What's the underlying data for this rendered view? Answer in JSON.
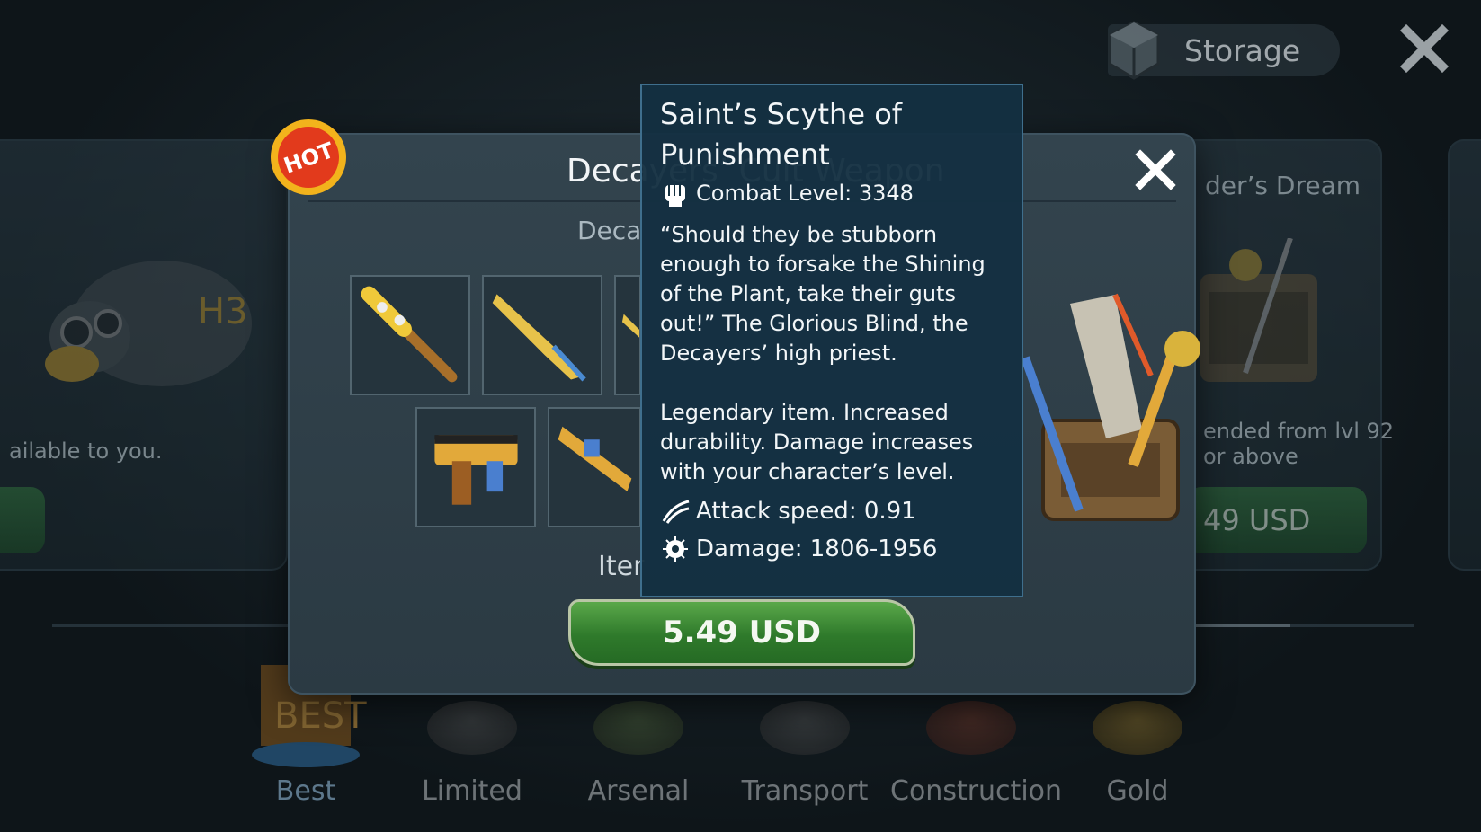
{
  "header": {
    "storage_label": "Storage",
    "storage_icon": "cube-icon",
    "close_icon": "close-icon"
  },
  "background_cards": {
    "left_text": "ailable to you.",
    "right_title": "der’s Dream",
    "right_text_line1": "ended from lvl 92",
    "right_text_line2": "or above",
    "right_price": "49 USD"
  },
  "bottom_nav": {
    "items": [
      {
        "label": "Best",
        "icon": "best-badge-icon",
        "active": true
      },
      {
        "label": "Limited",
        "icon": "limited-icon",
        "active": false
      },
      {
        "label": "Arsenal",
        "icon": "arsenal-crate-icon",
        "active": false
      },
      {
        "label": "Transport",
        "icon": "motorcycle-icon",
        "active": false
      },
      {
        "label": "Construction",
        "icon": "building-icon",
        "active": false
      },
      {
        "label": "Gold",
        "icon": "gold-bars-icon",
        "active": false
      }
    ]
  },
  "modal": {
    "title": "Decayers’ Cult Weapon",
    "subtitle": "Deca",
    "footer_text": "Iter",
    "hot_badge": "HOT",
    "price": "5.49 USD",
    "items": [
      {
        "icon": "spiked-club-icon"
      },
      {
        "icon": "scythe-blade-icon"
      },
      {
        "icon": "weapon-partial-icon"
      },
      {
        "icon": "machine-gun-icon"
      },
      {
        "icon": "rifle-icon"
      }
    ]
  },
  "tooltip": {
    "title": "Saint’s Scythe of Punishment",
    "combat_label": "Combat Level: 3348",
    "quote": "“Should they be stubborn enough to forsake the Shining of the Plant, take their guts out!” The Glorious Blind, the Decayers’ high priest.",
    "legend": "Legendary item. Increased durability. Damage increases with your character’s level.",
    "attack_speed": "Attack speed: 0.91",
    "damage": "Damage: 1806-1956"
  },
  "colors": {
    "tooltip_bg": "#14303f",
    "buy_button": "#2f7a2b",
    "hot_badge": "#e23a1c",
    "nav_active": "#9fc9ea"
  }
}
